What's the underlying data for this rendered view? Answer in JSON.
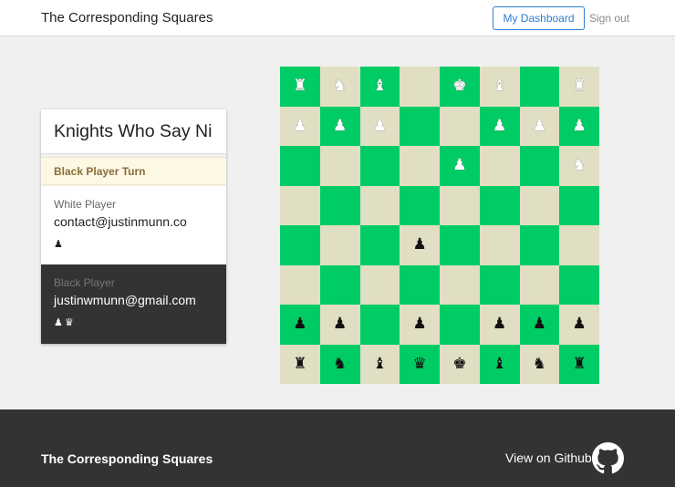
{
  "header": {
    "brand": "The Corresponding Squares",
    "dashboard_label": "My Dashboard",
    "signout_label": "Sign out"
  },
  "game": {
    "title": "Knights Who Say Ni",
    "turn_label": "Black Player Turn",
    "white": {
      "label": "White Player",
      "email": "contact@justinmunn.co",
      "captured": "♟"
    },
    "black": {
      "label": "Black Player",
      "email": "justinwmunn@gmail.com",
      "captured": "♟♛"
    }
  },
  "board": {
    "light_color": "#e0dfc3",
    "dark_color": "#00cc66",
    "rows": [
      [
        "wR",
        "wN",
        "wB",
        "",
        "wK",
        "wB",
        "",
        "wR"
      ],
      [
        "wP",
        "wP",
        "wP",
        "",
        "",
        "wP",
        "wP",
        "wP"
      ],
      [
        "",
        "",
        "",
        "",
        "wP",
        "",
        "",
        "wN"
      ],
      [
        "",
        "",
        "",
        "",
        "",
        "",
        "",
        ""
      ],
      [
        "",
        "",
        "",
        "bP",
        "",
        "",
        "",
        ""
      ],
      [
        "",
        "",
        "",
        "",
        "",
        "",
        "",
        ""
      ],
      [
        "bP",
        "bP",
        "",
        "bP",
        "",
        "bP",
        "bP",
        "bP"
      ],
      [
        "bR",
        "bN",
        "bB",
        "bQ",
        "bK",
        "bB",
        "bN",
        "bR"
      ]
    ]
  },
  "footer": {
    "brand": "The Corresponding Squares",
    "github_label": "View on Github",
    "github_icon": "github-icon"
  }
}
